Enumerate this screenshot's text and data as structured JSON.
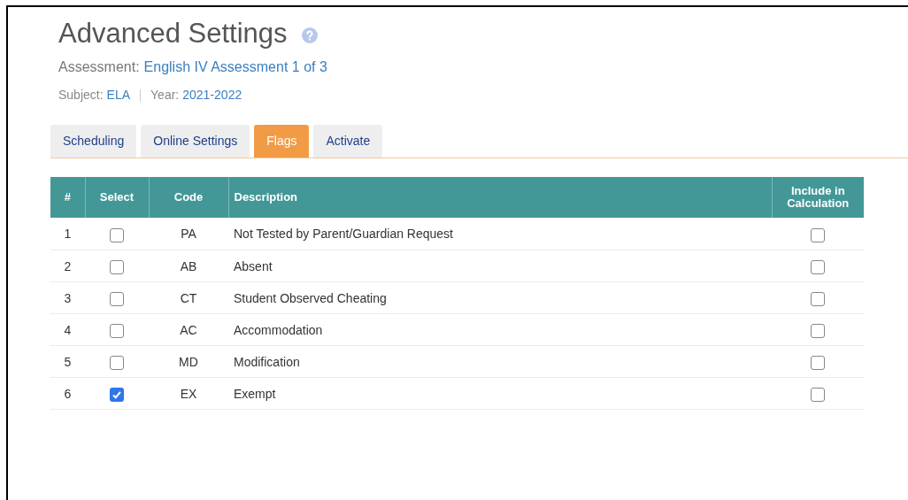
{
  "title": "Advanced Settings",
  "assessment": {
    "label": "Assessment:",
    "value": "English IV Assessment 1 of 3"
  },
  "subject": {
    "label": "Subject:",
    "value": "ELA"
  },
  "year": {
    "label": "Year:",
    "value": "2021-2022"
  },
  "tabs": [
    {
      "label": "Scheduling",
      "selected": false
    },
    {
      "label": "Online Settings",
      "selected": false
    },
    {
      "label": "Flags",
      "selected": true
    },
    {
      "label": "Activate",
      "selected": false
    }
  ],
  "table": {
    "columns": [
      "#",
      "Select",
      "Code",
      "Description",
      "Include in Calculation"
    ],
    "rows": [
      {
        "number": "1",
        "selected": false,
        "code": "PA",
        "description": "Not Tested by Parent/Guardian Request",
        "include": false
      },
      {
        "number": "2",
        "selected": false,
        "code": "AB",
        "description": "Absent",
        "include": false
      },
      {
        "number": "3",
        "selected": false,
        "code": "CT",
        "description": "Student Observed Cheating",
        "include": false
      },
      {
        "number": "4",
        "selected": false,
        "code": "AC",
        "description": "Accommodation",
        "include": false
      },
      {
        "number": "5",
        "selected": false,
        "code": "MD",
        "description": "Modification",
        "include": false
      },
      {
        "number": "6",
        "selected": true,
        "code": "EX",
        "description": "Exempt",
        "include": false
      }
    ]
  }
}
